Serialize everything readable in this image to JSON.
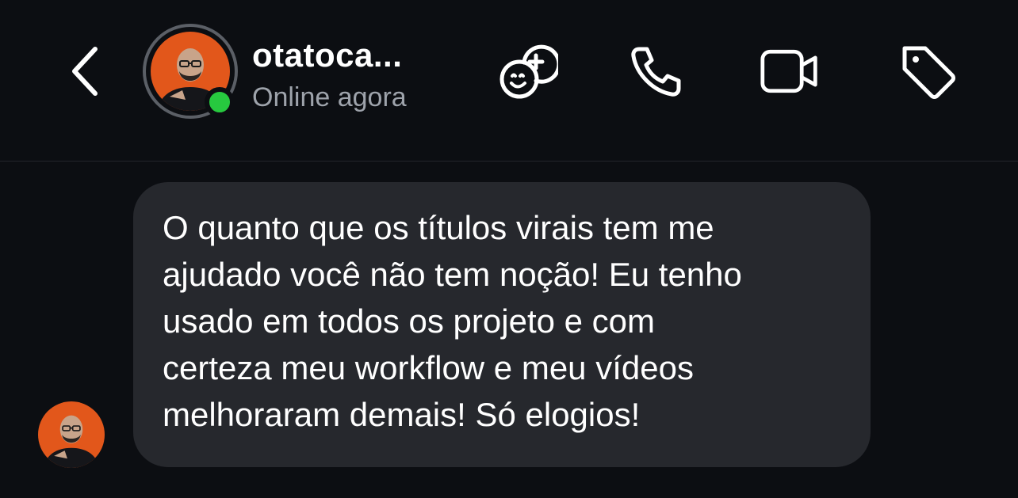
{
  "header": {
    "contact_name": "otatoca...",
    "status": "Online agora",
    "icons": {
      "back": "chevron-left-icon",
      "effects": "face-effects-add-icon",
      "call": "phone-icon",
      "video": "video-camera-icon",
      "tag": "tag-icon"
    },
    "online_color": "#27c93f"
  },
  "conversation": {
    "messages": [
      {
        "from": "contact",
        "text": "O quanto que os títulos virais tem me\najudado você não tem noção! Eu tenho\nusado em todos os projeto e com\ncerteza meu workflow e meu vídeos\nmelhoraram demais! Só elogios!"
      }
    ]
  },
  "theme": {
    "background": "#0c0e12",
    "bubble": "#26282d",
    "secondary_text": "#9ea3ab",
    "avatar_accent": "#e2571b"
  }
}
